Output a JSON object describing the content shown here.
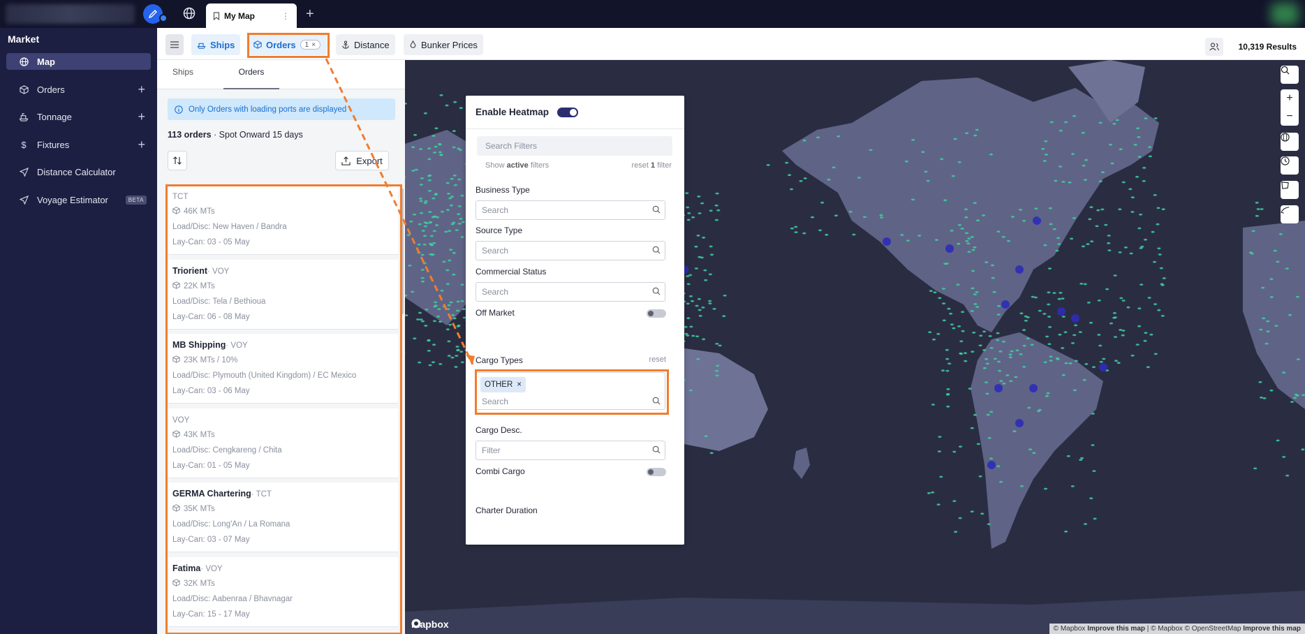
{
  "browser": {
    "tab_title": "My Map",
    "tab_dots": "⋮",
    "new_tab": "+"
  },
  "sidebar": {
    "section": "Market",
    "items": [
      {
        "label": "Map",
        "icon": "globe-icon",
        "active": true
      },
      {
        "label": "Orders",
        "icon": "cube-icon",
        "plus": "+"
      },
      {
        "label": "Tonnage",
        "icon": "ship-icon",
        "plus": "+"
      },
      {
        "label": "Fixtures",
        "icon": "dollar-icon",
        "plus": "+"
      },
      {
        "label": "Distance Calculator",
        "icon": "navigation-icon"
      },
      {
        "label": "Voyage Estimator",
        "icon": "navigation-icon",
        "badge": "BETA"
      }
    ]
  },
  "toolbar": {
    "ships": "Ships",
    "orders": "Orders",
    "orders_count": "1",
    "distance": "Distance",
    "bunker": "Bunker Prices",
    "results": "10,319 Results"
  },
  "panel": {
    "tabs": [
      "Ships",
      "Orders"
    ],
    "info": "Only Orders with loading ports are displayed",
    "count": "113 orders",
    "count_suffix": "· Spot Onward 15 days",
    "export": "Export",
    "orders": [
      {
        "name": "",
        "type": "TCT",
        "qty": "46K MTs",
        "load": "Load/Disc: New Haven / Bandra",
        "laycan": "Lay-Can: 03 - 05 May"
      },
      {
        "name": "Triorient",
        "type": "· VOY",
        "qty": "22K MTs",
        "load": "Load/Disc: Tela / Bethioua",
        "laycan": "Lay-Can: 06 - 08 May"
      },
      {
        "name": "MB Shipping",
        "type": "· VOY",
        "qty": "23K MTs / 10%",
        "load": "Load/Disc: Plymouth (United Kingdom) / EC Mexico",
        "laycan": "Lay-Can: 03 - 06 May"
      },
      {
        "name": "",
        "type": "VOY",
        "qty": "43K MTs",
        "load": "Load/Disc: Cengkareng / Chita",
        "laycan": "Lay-Can: 01 - 05 May"
      },
      {
        "name": "GERMA Chartering",
        "type": "· TCT",
        "qty": "35K MTs",
        "load": "Load/Disc: Long'An / La Romana",
        "laycan": "Lay-Can: 03 - 07 May"
      },
      {
        "name": "Fatima",
        "type": "· VOY",
        "qty": "32K MTs",
        "load": "Load/Disc: Aabenraa / Bhavnagar",
        "laycan": "Lay-Can: 15 - 17 May"
      }
    ]
  },
  "filters": {
    "heatmap": "Enable Heatmap",
    "search_placeholder": "Search Filters",
    "show_active_pre": "Show",
    "show_active_bold": "active",
    "show_active_post": "filters",
    "reset_pre": "reset",
    "reset_count": "1",
    "reset_post": "filter",
    "business_type": "Business Type",
    "source_type": "Source Type",
    "commercial_status": "Commercial Status",
    "off_market": "Off Market",
    "cargo_types": "Cargo Types",
    "cargo_reset": "reset",
    "cargo_chip": "OTHER",
    "cargo_desc": "Cargo Desc.",
    "combi_cargo": "Combi Cargo",
    "charter_duration": "Charter Duration",
    "search": "Search",
    "filter": "Filter"
  },
  "map": {
    "logo": "mapbox",
    "attribution_1": "© Mapbox",
    "attribution_2": "Improve this map",
    "attribution_3": "| © Mapbox © OpenStreetMap",
    "attribution_4": "Improve this map"
  },
  "colors": {
    "accent_orange": "#f07d2e",
    "sidebar_bg": "#1d1f42",
    "brand_blue": "#1c6fd1",
    "ocean": "#2a2d42",
    "land": "#5f6486",
    "heat_dot": "#3ecfa0"
  }
}
